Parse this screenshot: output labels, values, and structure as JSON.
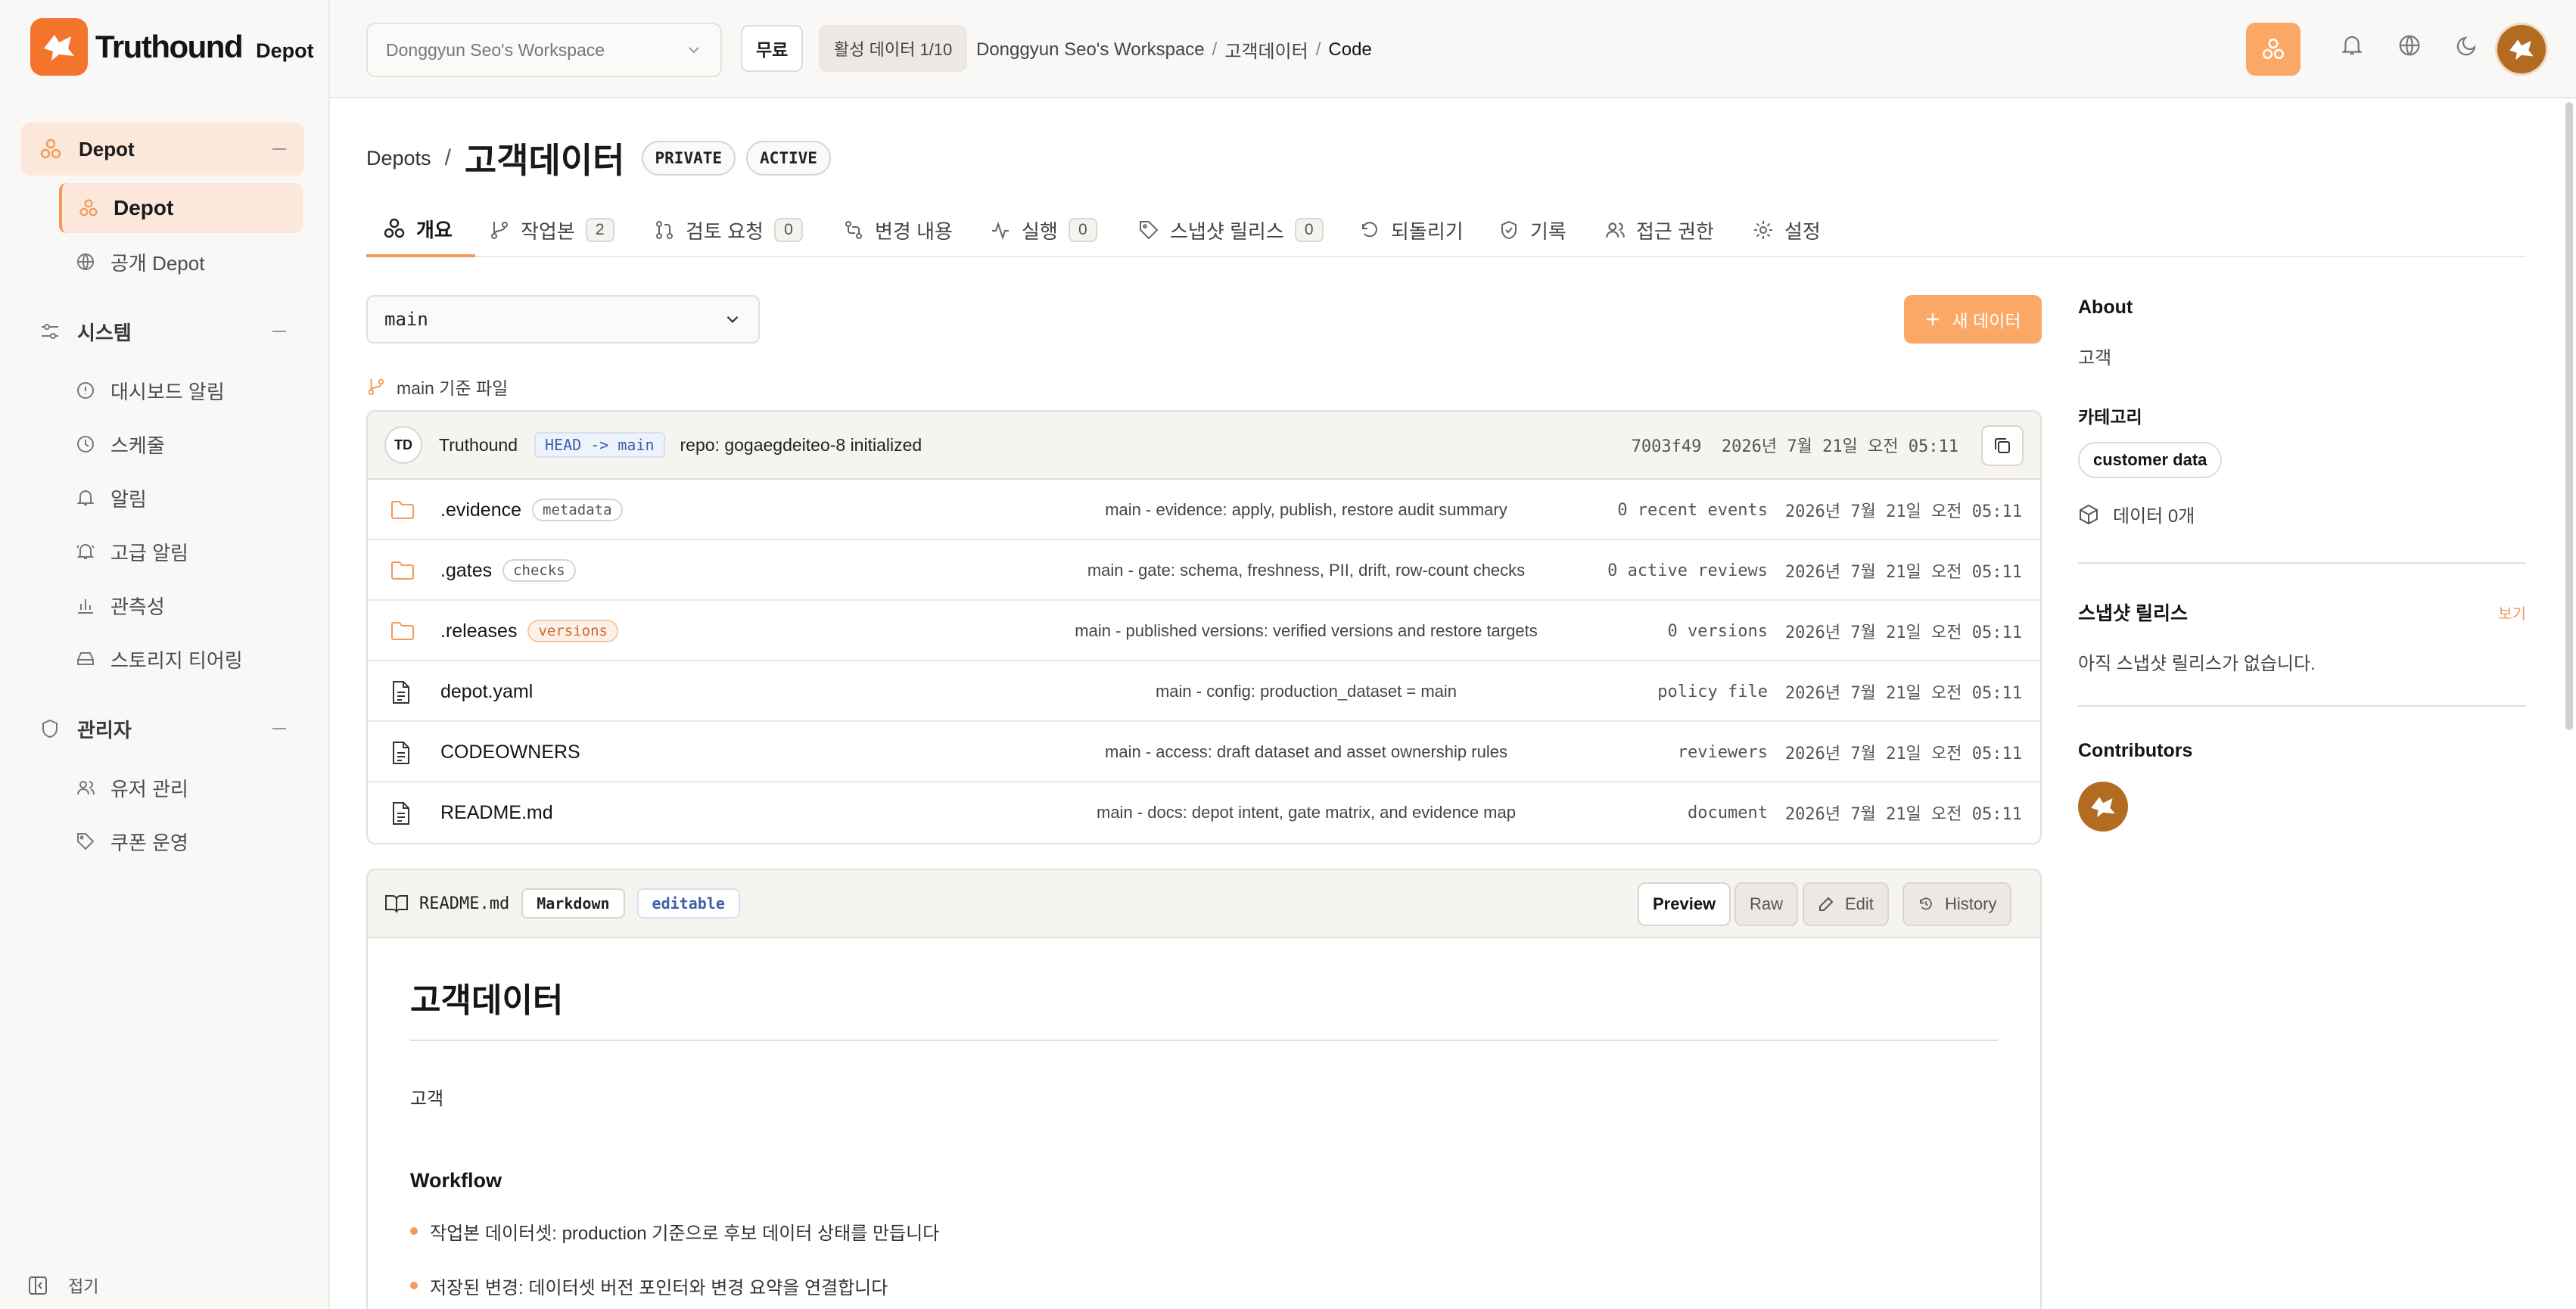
{
  "brand": {
    "name": "Truthound",
    "sub": "Depot"
  },
  "sidebar": {
    "groups": [
      {
        "label": "Depot",
        "items": [
          {
            "label": "Depot"
          },
          {
            "label": "공개 Depot"
          }
        ]
      },
      {
        "label": "시스템",
        "items": [
          {
            "label": "대시보드 알림"
          },
          {
            "label": "스케줄"
          },
          {
            "label": "알림"
          },
          {
            "label": "고급 알림"
          },
          {
            "label": "관측성"
          },
          {
            "label": "스토리지 티어링"
          }
        ]
      },
      {
        "label": "관리자",
        "items": [
          {
            "label": "유저 관리"
          },
          {
            "label": "쿠폰 운영"
          }
        ]
      }
    ],
    "collapse_label": "접기"
  },
  "topbar": {
    "workspace": "Donggyun Seo's Workspace",
    "plan": "무료",
    "active_data": "활성 데이터 1/10",
    "breadcrumb": [
      "Donggyun Seo's Workspace",
      "고객데이터",
      "Code"
    ]
  },
  "repo": {
    "root": "Depots",
    "title": "고객데이터",
    "visibility": "PRIVATE",
    "status": "ACTIVE"
  },
  "tabs": [
    {
      "label": "개요"
    },
    {
      "label": "작업본",
      "count": "2"
    },
    {
      "label": "검토 요청",
      "count": "0"
    },
    {
      "label": "변경 내용"
    },
    {
      "label": "실행",
      "count": "0"
    },
    {
      "label": "스냅샷 릴리스",
      "count": "0"
    },
    {
      "label": "되돌리기"
    },
    {
      "label": "기록"
    },
    {
      "label": "접근 권한"
    },
    {
      "label": "설정"
    }
  ],
  "branch": {
    "selected": "main",
    "based_label": "main 기준 파일",
    "new_data_label": "새 데이터"
  },
  "commit": {
    "avatar": "TD",
    "author": "Truthound",
    "head": "HEAD -> main",
    "message": "repo: gogaegdeiteo-8 initialized",
    "hash": "7003f49",
    "date": "2026년 7월 21일 오전 05:11"
  },
  "files": [
    {
      "name": ".evidence",
      "tag": "metadata",
      "message": "main - evidence: apply, publish, restore audit summary",
      "status": "0 recent events",
      "date": "2026년 7월 21일 오전 05:11"
    },
    {
      "name": ".gates",
      "tag": "checks",
      "message": "main - gate: schema, freshness, PII, drift, row-count checks",
      "status": "0 active reviews",
      "date": "2026년 7월 21일 오전 05:11"
    },
    {
      "name": ".releases",
      "tag": "versions",
      "message": "main - published versions: verified versions and restore targets",
      "status": "0 versions",
      "date": "2026년 7월 21일 오전 05:11"
    },
    {
      "name": "depot.yaml",
      "message": "main - config: production_dataset = main",
      "status": "policy file",
      "date": "2026년 7월 21일 오전 05:11"
    },
    {
      "name": "CODEOWNERS",
      "message": "main - access: draft dataset and asset ownership rules",
      "status": "reviewers",
      "date": "2026년 7월 21일 오전 05:11"
    },
    {
      "name": "README.md",
      "message": "main - docs: depot intent, gate matrix, and evidence map",
      "status": "document",
      "date": "2026년 7월 21일 오전 05:11"
    }
  ],
  "readme": {
    "filename": "README.md",
    "tag1": "Markdown",
    "tag2": "editable",
    "buttons": [
      "Preview",
      "Raw",
      "Edit",
      "History"
    ],
    "title": "고객데이터",
    "desc": "고객",
    "section": "Workflow",
    "bullets": [
      "작업본 데이터셋: production 기준으로 후보 데이터 상태를 만듭니다",
      "저장된 변경: 데이터셋 버전 포인터와 변경 요약을 연결합니다"
    ]
  },
  "about": {
    "heading": "About",
    "desc": "고객",
    "category_heading": "카테고리",
    "category": "customer data",
    "data_count": "데이터 0개",
    "snapshot_heading": "스냅샷 릴리스",
    "snapshot_view": "보기",
    "snapshot_empty": "아직 스냅샷 릴리스가 없습니다.",
    "contributors_heading": "Contributors"
  },
  "colors": {
    "accent": "#f4742b",
    "accent_soft": "#fba866",
    "active_bg": "#fbe8da"
  }
}
